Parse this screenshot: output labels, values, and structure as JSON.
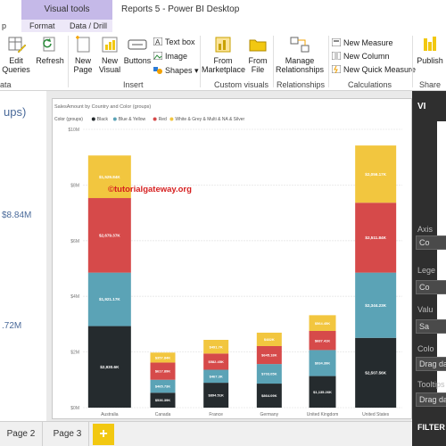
{
  "title_bar": {
    "contextual_tools": "Visual tools",
    "window_title": "Reports 5 - Power BI Desktop"
  },
  "tabs": {
    "partial_left": "p",
    "format": "Format",
    "data_drill": "Data / Drill"
  },
  "ribbon": {
    "edit_queries": "Edit",
    "edit_queries_2": "Queries",
    "refresh": "Refresh",
    "new_page": "New",
    "new_page_2": "Page",
    "new_visual": "New",
    "new_visual_2": "Visual",
    "buttons": "Buttons",
    "text_box": "Text box",
    "image": "Image",
    "shapes": "Shapes",
    "from_marketplace": "From",
    "from_marketplace_2": "Marketplace",
    "from_file": "From",
    "from_file_2": "File",
    "manage_relationships": "Manage",
    "manage_relationships_2": "Relationships",
    "new_measure": "New Measure",
    "new_column": "New Column",
    "new_quick_measure": "New Quick Measure",
    "publish": "Publish",
    "groups": {
      "data": "ata",
      "insert": "Insert",
      "custom_visuals": "Custom visuals",
      "relationships": "Relationships",
      "calculations": "Calculations",
      "share": "Share"
    }
  },
  "background_visual": {
    "title_fragment": "ups)",
    "value_1": "$8.84M",
    "value_2": ".72M"
  },
  "chart_data": {
    "type": "bar",
    "stacked": true,
    "title": "SalesAmount by Country and Color (groups)",
    "legend_title": "Color (groups)",
    "watermark": "©tutorialgateway.org",
    "categories": [
      "Australia",
      "Canada",
      "France",
      "Germany",
      "United Kingdom",
      "United States"
    ],
    "y_ticks": [
      "$0M",
      "$2M",
      "$4M",
      "$6M",
      "$8M",
      "$10M"
    ],
    "ylim": [
      0,
      10000000
    ],
    "grid": true,
    "legend_position": "top-left",
    "series": [
      {
        "name": "Black",
        "color": "#252b2e",
        "values": [
          2930600,
          536390,
          894510,
          864090,
          1135260,
          2507560
        ],
        "labels": [
          "$2,930.6K",
          "$536.39K",
          "$894.51K",
          "$864.09K",
          "$1,135.26K",
          "$2,507.56K"
        ]
      },
      {
        "name": "Blue & Yellow",
        "color": "#5ba3b6",
        "values": [
          1921170,
          465730,
          467300,
          703050,
          934390,
          2344230
        ],
        "labels": [
          "$1,921.17K",
          "$465.73K",
          "$467.3K",
          "$703.05K",
          "$934.39K",
          "$2,344.23K"
        ]
      },
      {
        "name": "Red",
        "color": "#d64a4a",
        "values": [
          2679370,
          617890,
          582450,
          645180,
          687410,
          2511840
        ],
        "labels": [
          "$2,679.37K",
          "$617.89K",
          "$582.45K",
          "$645.18K",
          "$687.41K",
          "$2,511.84K"
        ]
      },
      {
        "name": "White & Grey & Multi & NA & Silver",
        "color": "#f2c63f",
        "values": [
          1529840,
          357840,
          491700,
          482000,
          564450,
          2056170
        ],
        "labels": [
          "$1,529.84K",
          "$357.84K",
          "$491.7K",
          "$482K",
          "$564.45K",
          "$2,056.17K"
        ]
      }
    ]
  },
  "right_pane": {
    "header": "VI",
    "labels": [
      "Axis",
      "Lege",
      "Valu",
      "Colo",
      "Tooltips"
    ],
    "fields": [
      "Co",
      "Co",
      "Sa"
    ],
    "drag": "Drag da",
    "drag_2": "Drag da",
    "filters": "FILTER"
  },
  "page_tabs": {
    "page2": "Page 2",
    "page3": "Page 3",
    "add": "+"
  }
}
